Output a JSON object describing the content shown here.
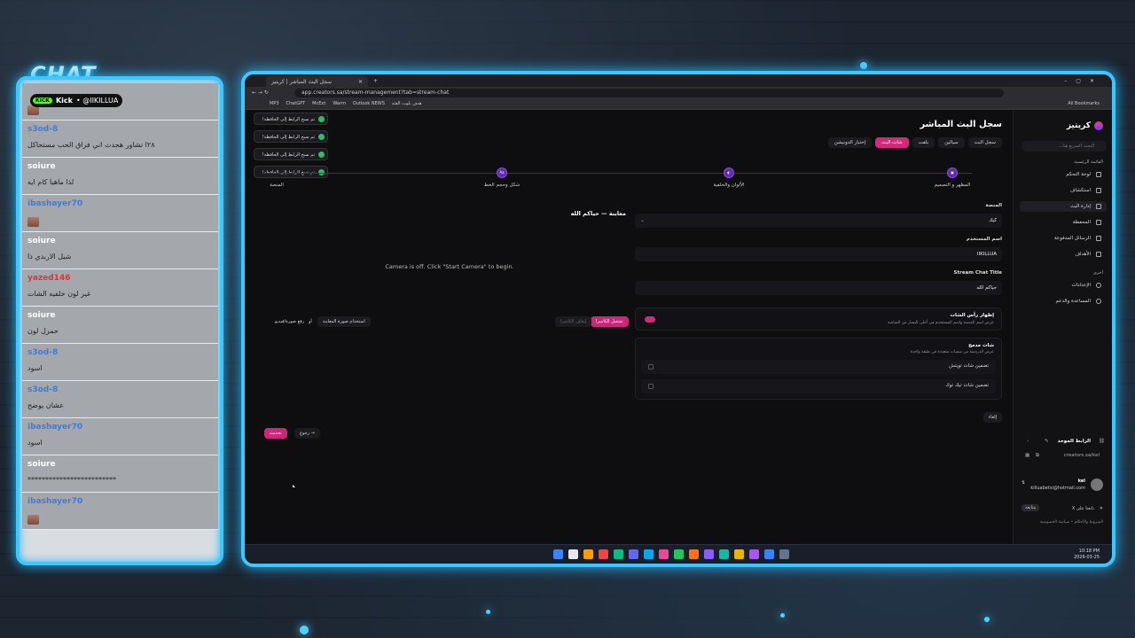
{
  "overlay": {
    "chat_heading": "CHAT",
    "kick_badge": "Kick",
    "kick_channel": "• @IIKILLUA",
    "messages": [
      {
        "user": "",
        "text": "",
        "user_color": "#3d7be0",
        "emote": true
      },
      {
        "user": "s3od-8",
        "text": "٢٨ا تشاور هجدث اني فراق الحب مستحاكل",
        "user_color": "#3d7be0",
        "emote": false
      },
      {
        "user": "soiure",
        "text": "لذا ماهيا كام ايه",
        "user_color": "#ffffff",
        "emote": false
      },
      {
        "user": "ibashayer70",
        "text": "",
        "user_color": "#3d7be0",
        "emote": true
      },
      {
        "user": "soiure",
        "text": "شيل الاربدي ذا",
        "user_color": "#ffffff",
        "emote": false
      },
      {
        "user": "yazed146",
        "text": "غير لون خلفيه الشات",
        "user_color": "#e0333a",
        "emote": false
      },
      {
        "user": "soiure",
        "text": "حمرل لون",
        "user_color": "#ffffff",
        "emote": false
      },
      {
        "user": "s3od-8",
        "text": "اسود",
        "user_color": "#3d7be0",
        "emote": false
      },
      {
        "user": "s3od-8",
        "text": "عشان يوضح",
        "user_color": "#3d7be0",
        "emote": false
      },
      {
        "user": "ibashayer70",
        "text": "اسود",
        "user_color": "#3d7be0",
        "emote": false
      },
      {
        "user": "soiure",
        "text": "*************************",
        "user_color": "#ffffff",
        "emote": false
      },
      {
        "user": "ibashayer70",
        "text": "",
        "user_color": "#3d7be0",
        "emote": true
      }
    ]
  },
  "browser": {
    "tab_title": "سجل البث المباشر | كريتيز",
    "url": "app.creators.sa/stream-management?tab=stream-chat",
    "bookmarks": [
      "MP3",
      "ChatGPT",
      "McExt",
      "Warm",
      "Outlook NEWS",
      "هدف بلوت الفئة"
    ],
    "all_bookmarks": "All Bookmarks"
  },
  "sidebar": {
    "brand": "كريتيز",
    "search_placeholder": "البحث السريع هنا...",
    "main_section": "القائمة الرئيسية",
    "items": [
      {
        "label": "لوحة التحكم",
        "active": false
      },
      {
        "label": "استكشاف",
        "active": false
      },
      {
        "label": "إدارة البث",
        "active": true
      },
      {
        "label": "المحفظة",
        "active": false
      },
      {
        "label": "الرسائل المدفوعة",
        "active": false
      },
      {
        "label": "الأهداف",
        "active": false
      }
    ],
    "other_section": "أخرى",
    "other_items": [
      {
        "label": "الإعدادات"
      },
      {
        "label": "المساعدة والدعم"
      }
    ],
    "unified_link_title": "الرابط الموحد",
    "unified_link": "creators.sa/kel",
    "user_name": "kel",
    "user_email": "killuabetsi@hotmail.com",
    "follow_x": "تابعنا على X",
    "follow_btn": "متابعة",
    "footer_terms": "الشروط والأحكام",
    "footer_privacy": "سياسة الخصوصية"
  },
  "main": {
    "page_title": "سجل البث المباشر",
    "tabs": [
      {
        "label": "سجل البث",
        "active": false
      },
      {
        "label": "سيالين",
        "active": false
      },
      {
        "label": "بلفت",
        "active": false
      },
      {
        "label": "شات البث",
        "active": true
      },
      {
        "label": "إختبار الدونيشن",
        "active": false
      }
    ],
    "toasts": [
      "تم نسخ الرابط إلى الحافظة!",
      "تم نسخ الرابط إلى الحافظة!",
      "تم نسخ الرابط إلى الحافظة!",
      "تم نسخ الرابط إلى الحافظة!"
    ],
    "steps": [
      {
        "label": "المظهر و التصميم",
        "icon": "▣"
      },
      {
        "label": "الألوان والخلفية",
        "icon": "◐"
      },
      {
        "label": "شكل وحجم الخط",
        "icon": "Aa"
      },
      {
        "label": "المنصة",
        "icon": ""
      }
    ],
    "form": {
      "platform_label": "المنصة",
      "platform_value": "كيك",
      "username_label": "اسم المستخدم",
      "username_value": "IIKILLUA",
      "chat_title_label": "Stream Chat Title",
      "chat_title_value": "حياكم الله",
      "show_header_label": "إظهار رأس الشات",
      "show_header_desc": "عرض اسم المنصة واسم المستخدم في أعلى اليسار من الشاشة",
      "merged_label": "شات مدمج",
      "merged_desc": "عرض الدردشة من منصات متعددة في طبقة واحدة",
      "include_tiktok": "تضمين شات تويتش",
      "include_youtube": "تضمين شات تيك توك",
      "cancel": "إلغاء"
    },
    "preview": {
      "title": "معاينة — حياكم الله",
      "camera_msg": "Camera is off. Click \"Start Camera\" to begin.",
      "start_camera": "تشغيل الكاميرا",
      "stop_camera": "إيقاف الكاميرا",
      "use_preview_image": "استخدام صورة المعاينة",
      "or": "أو",
      "upload": "رفع صورة/فيديو",
      "update": "تحديث",
      "back": "رجوع"
    }
  },
  "taskbar": {
    "time": "10:18 PM",
    "date": "2026-03-25"
  }
}
